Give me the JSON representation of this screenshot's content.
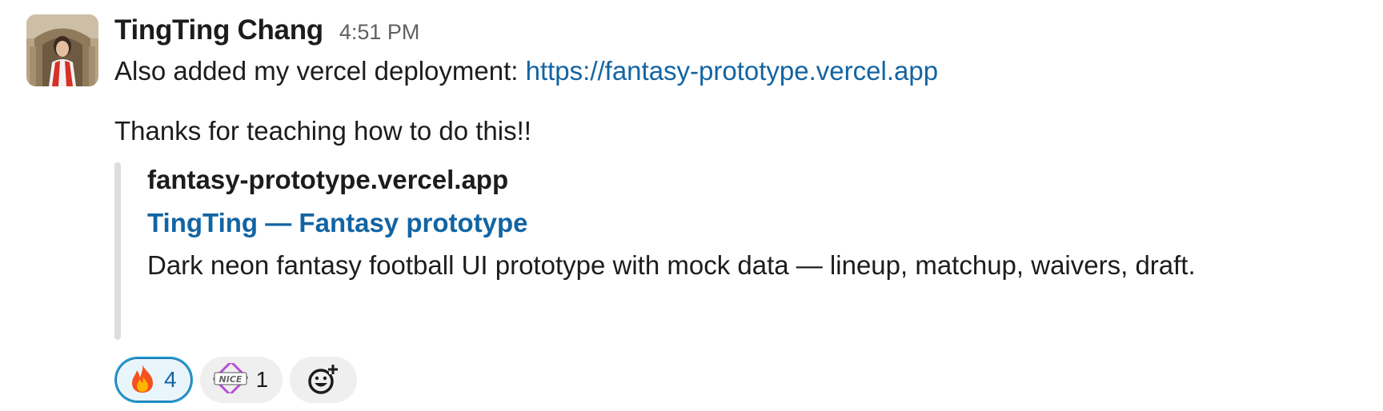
{
  "message": {
    "sender": "TingTing Chang",
    "timestamp": "4:51 PM",
    "line1_prefix": "Also added my vercel deployment: ",
    "line1_link": "https://fantasy-prototype.vercel.app",
    "line2": "Thanks for teaching how to do this!!"
  },
  "unfurl": {
    "site": "fantasy-prototype.vercel.app",
    "title": "TingTing — Fantasy prototype",
    "description": "Dark neon fantasy football UI prototype with mock data — lineup, matchup, waivers, draft."
  },
  "reactions": [
    {
      "emoji": "fire",
      "count": "4",
      "active": true
    },
    {
      "emoji": "nice",
      "count": "1",
      "active": false
    }
  ],
  "icons": {
    "add_reaction": "add-reaction-icon"
  },
  "colors": {
    "link": "#1264a3",
    "active_reaction_border": "#1d9bd1",
    "unfurl_bar": "#dddddd"
  }
}
